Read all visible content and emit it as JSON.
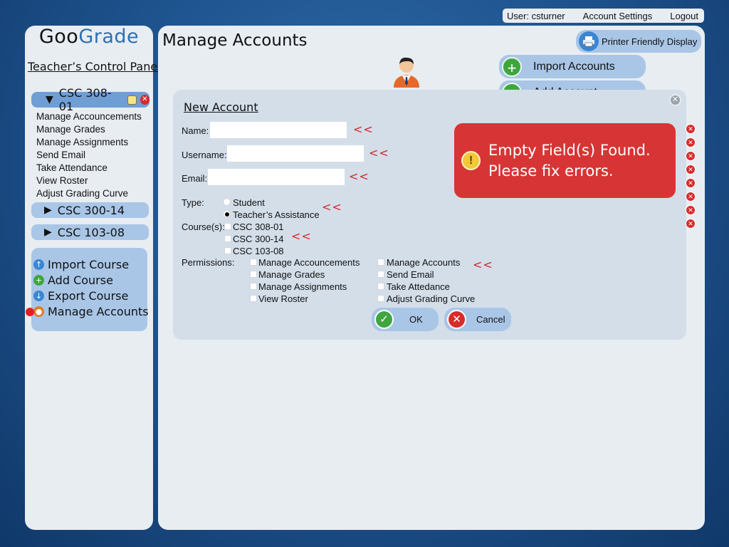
{
  "topbar": {
    "user": "User: csturner",
    "account_settings": "Account Settings",
    "logout": "Logout"
  },
  "sidebar": {
    "logo_part1": "Goo",
    "logo_part2": "Grade",
    "panel_title": "Teacher’s Control Panel",
    "active_course": "CSC 308-01",
    "course_menu": [
      "Manage Accouncements",
      "Manage Grades",
      "Manage Assignments",
      "Send Email",
      "Take Attendance",
      "View Roster",
      "Adjust Grading Curve"
    ],
    "courses": [
      "CSC 300-14",
      "CSC 103-08"
    ],
    "actions": [
      "Import Course",
      "Add Course",
      "Export Course",
      "Manage Accounts"
    ]
  },
  "main": {
    "title": "Manage Accounts",
    "printer_button": "Printer Friendly Display",
    "import_accounts": "Import Accounts",
    "add_account": "Add Account"
  },
  "dialog": {
    "title": "New Account",
    "name_label": "Name:",
    "username_label": "Username:",
    "email_label": "Email:",
    "name_value": "",
    "username_value": "",
    "email_value": "",
    "error_mark": "<<",
    "type_label": "Type:",
    "type_options": [
      "Student",
      "Teacher’s Assistance"
    ],
    "type_selected": "Teacher’s Assistance",
    "courses_label": "Course(s):",
    "course_options": [
      "CSC 308-01",
      "CSC 300-14",
      "CSC 103-08"
    ],
    "permissions_label": "Permissions:",
    "permissions_col1": [
      "Manage Accouncements",
      "Manage Grades",
      "Manage Assignments",
      "View Roster"
    ],
    "permissions_col2": [
      "Manage Accounts",
      "Send Email",
      "Take Attedance",
      "Adjust Grading Curve"
    ],
    "ok": "OK",
    "cancel": "Cancel"
  },
  "error": {
    "line1": "Empty Field(s) Found.",
    "line2": "Please fix errors."
  },
  "icons": {
    "printer": "printer-icon",
    "user_avatar": "user-avatar-icon",
    "add": "plus-icon",
    "close": "close-icon",
    "warning": "warning-icon",
    "ok": "check-icon",
    "cancel": "x-icon"
  },
  "colors": {
    "pill_blue": "#a9c6e7",
    "active_pill": "#6f9ed5",
    "error_red": "#d73535",
    "panel_bg": "#e8edf2",
    "dialog_bg": "#d3dee9"
  }
}
